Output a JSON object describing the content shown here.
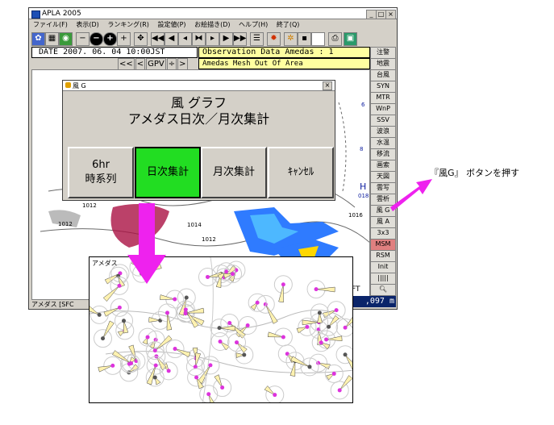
{
  "window": {
    "title": "APLA 2005",
    "buttons": {
      "minimize": "_",
      "maximize": "□",
      "close": "×"
    }
  },
  "menu": {
    "items": [
      "ファイル(F)",
      "表示(D)",
      "ランキング(R)",
      "設定値(P)",
      "お絵描き(D)",
      "ヘルプ(H)",
      "終了(Q)"
    ]
  },
  "toolbar": {
    "buttons": [
      "◀",
      "▶",
      "−",
      "⊖",
      "⊕",
      "+",
      "⊕",
      "◀◀",
      "◀",
      "▶▶",
      "▶",
      "▶",
      "▶▶"
    ]
  },
  "info": {
    "date": "DATE 2007. 06. 04  10:00JST",
    "observation": "Observation Data Amedas : 1",
    "mesh": "Amedas Mesh Out Of Area",
    "nav": [
      "<<",
      "<",
      "GPV",
      "÷",
      ">",
      ">>"
    ],
    "ft": "FT",
    "status_left": "アメダス [SFC",
    "status_right": ",097 m"
  },
  "side_buttons": [
    "注警",
    "地震",
    "台風",
    "SYN",
    "MTR",
    "WnP",
    "SSV",
    "波浪",
    "水温",
    "移流",
    "画索",
    "天図",
    "雲写",
    "雲析",
    "風 G",
    "風 A",
    "3x3",
    "MSM",
    "RSM",
    "Init",
    "|||||"
  ],
  "map_labels": {
    "isobars": [
      "1012",
      "1012",
      "1014",
      "1012",
      "1016"
    ],
    "pressure_center": "H",
    "pressure_value": "018",
    "numbers": [
      "6",
      "8"
    ]
  },
  "dialog": {
    "title": "風 G",
    "close": "×",
    "heading_line1": "風 グラフ",
    "heading_line2": "アメダス日次／月次集計",
    "buttons": [
      {
        "line1": "6hr",
        "line2": "時系列"
      },
      {
        "line1": "日次集計",
        "line2": ""
      },
      {
        "line1": "月次集計",
        "line2": ""
      },
      {
        "line1": "ｷｬﾝｾﾙ",
        "line2": ""
      }
    ]
  },
  "overlay": {
    "label": "アメダス"
  },
  "annotation": {
    "text": "『風G』 ボタンを押す"
  },
  "colors": {
    "dialog_highlight": "#22dd22",
    "arrow": "#ee22ee",
    "msm_button": "#e08080",
    "info_bar": "#ffffa0"
  }
}
